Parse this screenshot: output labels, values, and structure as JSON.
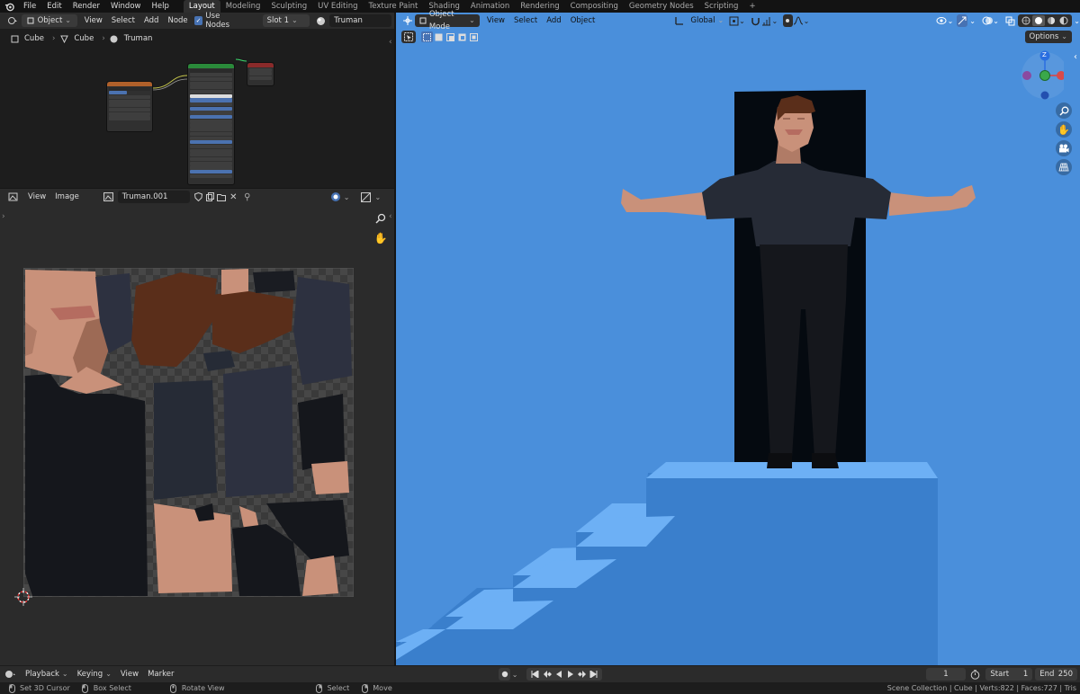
{
  "topbar": {
    "menus": [
      "File",
      "Edit",
      "Render",
      "Window",
      "Help"
    ],
    "workspaces": [
      "Layout",
      "Modeling",
      "Sculpting",
      "UV Editing",
      "Texture Paint",
      "Shading",
      "Animation",
      "Rendering",
      "Compositing",
      "Geometry Nodes",
      "Scripting"
    ],
    "active_workspace": "Layout",
    "add_tab": "+"
  },
  "node_editor": {
    "object_mode": "Object",
    "menus": [
      "View",
      "Select",
      "Add",
      "Node"
    ],
    "use_nodes_label": "Use Nodes",
    "slot": "Slot 1",
    "material": "Truman",
    "breadcrumb": [
      "Cube",
      "Cube",
      "Truman"
    ]
  },
  "image_editor": {
    "menus": [
      "View",
      "Image"
    ],
    "image_name": "Truman.001"
  },
  "viewport": {
    "mode": "Object Mode",
    "menus": [
      "View",
      "Select",
      "Add",
      "Object"
    ],
    "transform_orientation": "Global",
    "options_label": "Options",
    "gizmo_z": "Z"
  },
  "timeline": {
    "menus": [
      "Playback",
      "Keying",
      "View",
      "Marker"
    ],
    "current_frame": "1",
    "start_label": "Start",
    "start_value": "1",
    "end_label": "End",
    "end_value": "250"
  },
  "statusbar": {
    "hints": [
      "Set 3D Cursor",
      "Box Select",
      "Rotate View",
      "Select",
      "Move"
    ],
    "stats": "Scene Collection | Cube | Verts:822 | Faces:727 | Tris"
  },
  "colors": {
    "viewport_bg": "#4a8fdb",
    "stairs_top": "#6db0f5",
    "stairs_front": "#3a7fcc",
    "skin": "#c9917a",
    "hair": "#5a2e1a",
    "shirt": "#262b36",
    "pants": "#15171c",
    "doorway": "#050a10",
    "active_tab": "#2f2f2f",
    "accent_blue": "#4772b3"
  }
}
